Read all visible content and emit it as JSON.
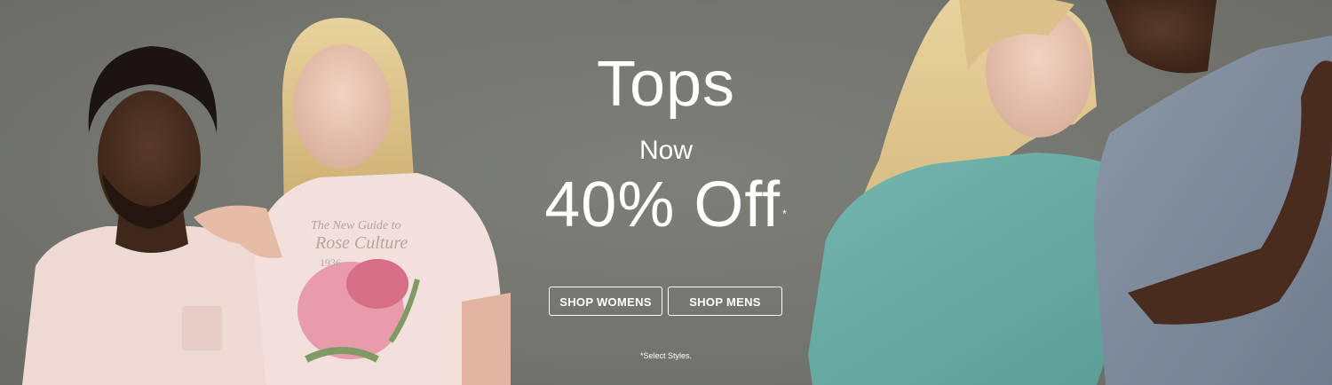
{
  "promo": {
    "headline": "Tops",
    "subline": "Now",
    "offer": "40% Off",
    "offer_mark": "*",
    "disclaimer": "*Select Styles."
  },
  "buttons": {
    "women_label": "SHOP WOMENS",
    "men_label": "SHOP MENS"
  },
  "tee_print": {
    "line1": "The New Guide to",
    "line2": "Rose Culture",
    "line3": "1936"
  },
  "colors": {
    "background": "#74756f",
    "text": "#ffffff",
    "button_border": "#ffffff"
  }
}
